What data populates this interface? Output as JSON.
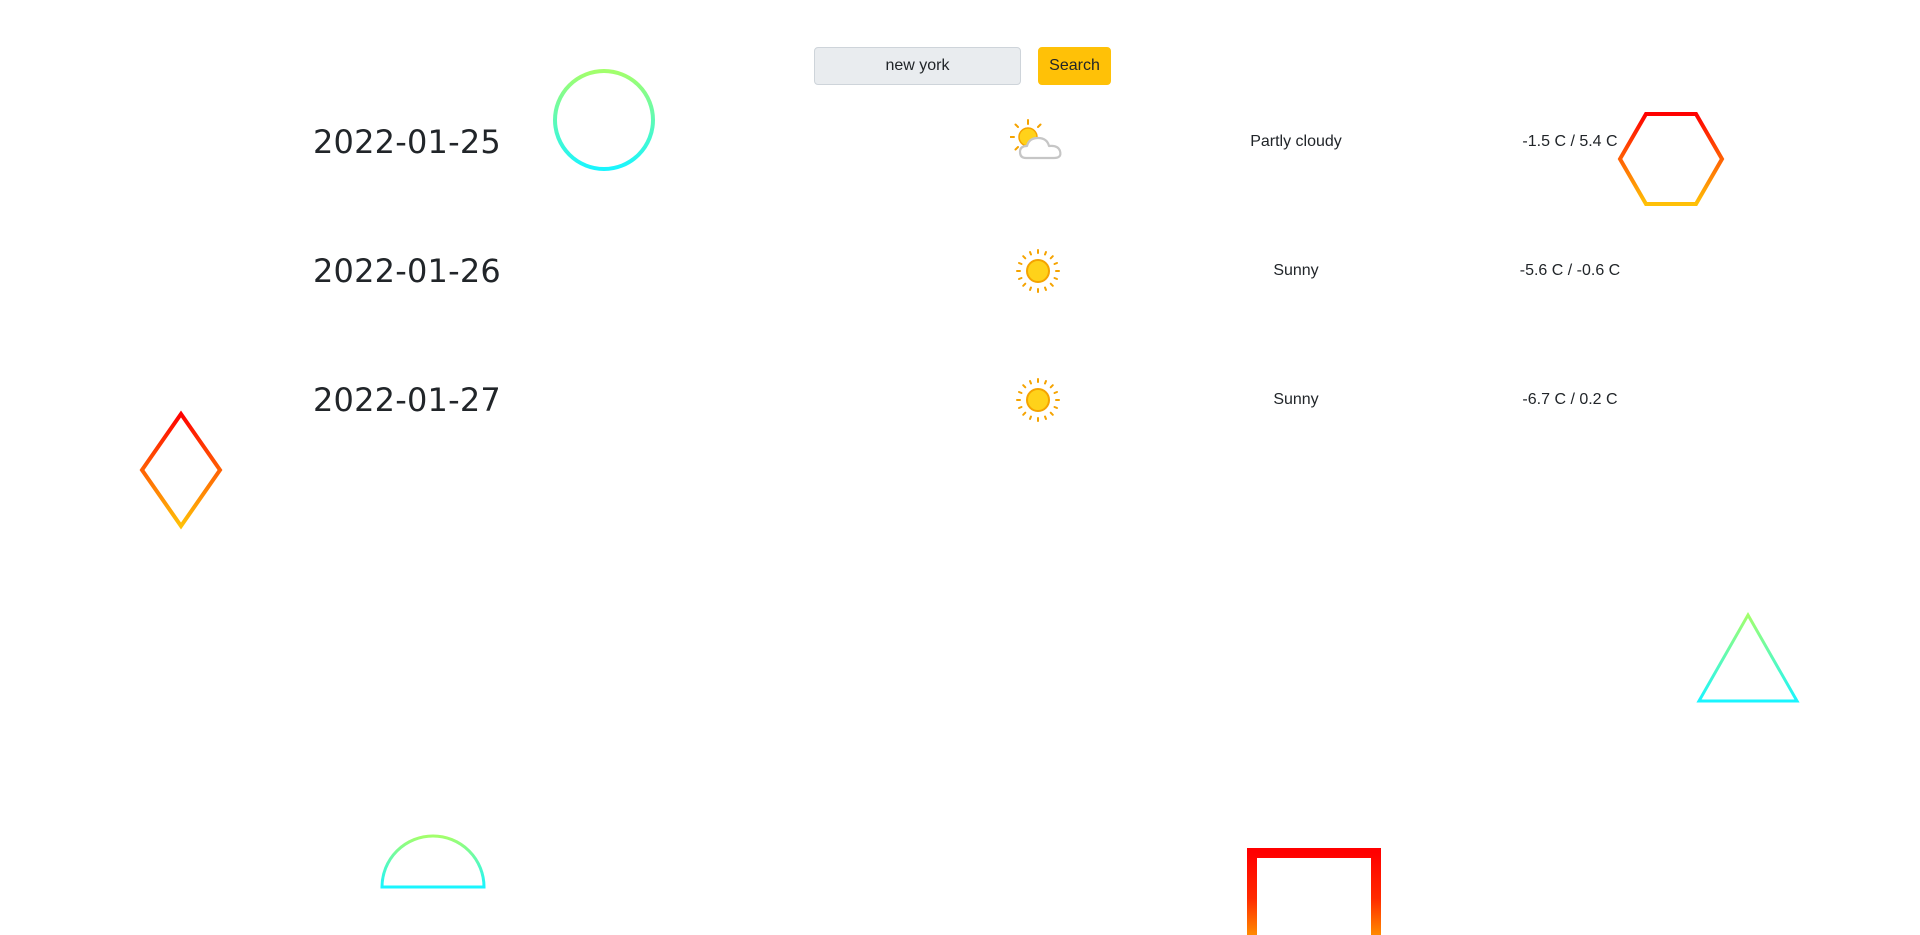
{
  "search": {
    "value": "new york",
    "button_label": "Search"
  },
  "forecast": [
    {
      "date": "2022-01-25",
      "icon": "partly-cloudy-icon",
      "condition": "Partly cloudy",
      "temperature": "-1.5 C / 5.4 C"
    },
    {
      "date": "2022-01-26",
      "icon": "sun-icon",
      "condition": "Sunny",
      "temperature": "-5.6 C / -0.6 C"
    },
    {
      "date": "2022-01-27",
      "icon": "sun-icon",
      "condition": "Sunny",
      "temperature": "-6.7 C / 0.2 C"
    }
  ],
  "colors": {
    "accent": "#ffc107",
    "input_bg": "#e9ecef",
    "text": "#212529",
    "shape_warm_start": "#ff0000",
    "shape_warm_end": "#ffc107",
    "shape_cool_start": "#a3ff6b",
    "shape_cool_end": "#19f5ff"
  },
  "decor": {
    "shapes": [
      "circle-outline",
      "hexagon-outline",
      "diamond-outline",
      "triangle-outline",
      "half-circle-outline",
      "open-square-outline"
    ]
  }
}
